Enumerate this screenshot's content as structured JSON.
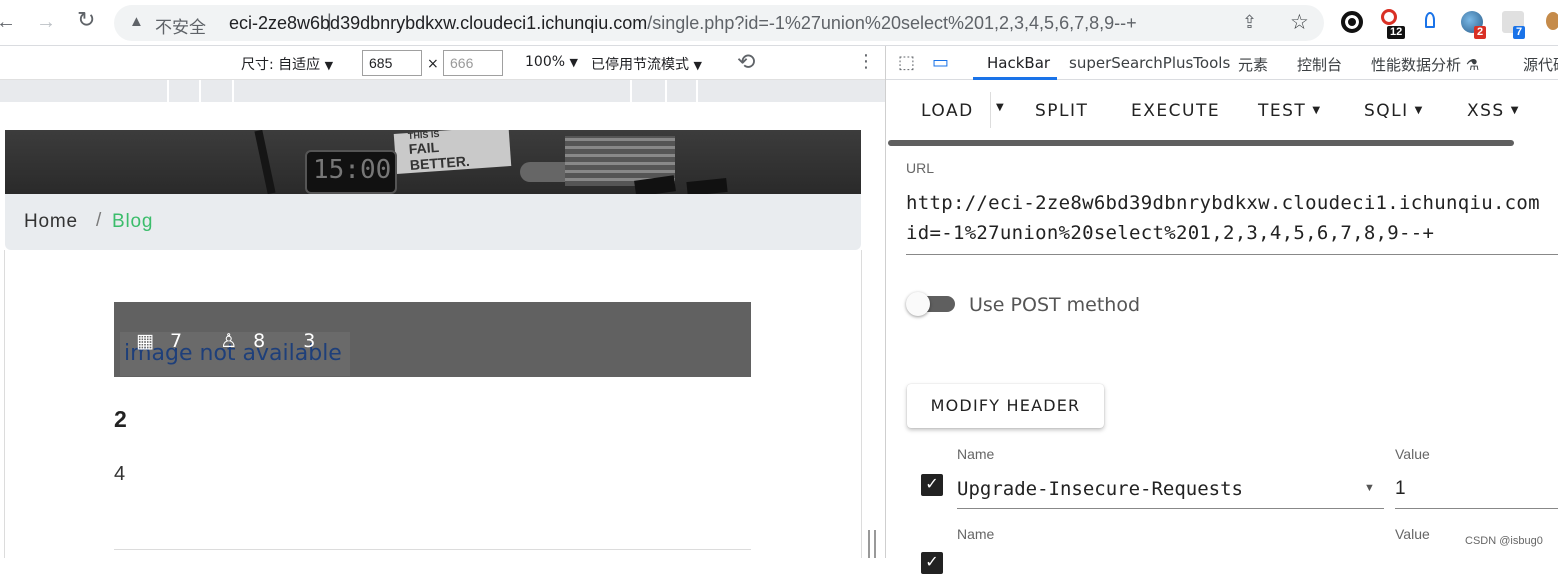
{
  "browser": {
    "security_warning": "不安全",
    "separator": "|",
    "url_host": "eci-2ze8w6bd39dbnrybdkxw.cloudeci1.ichunqiu.com",
    "url_path": "/single.php?id=-1%27union%20select%201,2,3,4,5,6,7,8,9--+",
    "ext_badges": [
      "12",
      "2",
      "7"
    ]
  },
  "device_toolbar": {
    "size_label": "尺寸: 自适应",
    "width": "685",
    "height_placeholder": "666",
    "times": "×",
    "zoom": "100%",
    "throttle": "已停用节流模式"
  },
  "page": {
    "hero_sign": "FAIL BETTER.",
    "hero_sign_top": "THIS IS",
    "hero_clock": "15:00",
    "breadcrumb": {
      "home": "Home",
      "slash": "/",
      "current": "Blog"
    },
    "broken_image_alt": "image not available",
    "meta_date": "7",
    "meta_author": "8",
    "meta_comments": "3",
    "post_title": "2",
    "post_body": "4"
  },
  "devtools": {
    "tabs": [
      "HackBar",
      "superSearchPlusTools",
      "元素",
      "控制台",
      "性能数据分析",
      "源代码"
    ],
    "hackbar": {
      "buttons": [
        "LOAD",
        "SPLIT",
        "EXECUTE",
        "TEST",
        "SQLI",
        "XSS"
      ],
      "url_label": "URL",
      "url_line1": "http://eci-2ze8w6bd39dbnrybdkxw.cloudeci1.ichunqiu.com",
      "url_line2": "id=-1%27union%20select%201,2,3,4,5,6,7,8,9--+",
      "post_toggle_label": "Use POST method",
      "post_enabled": false,
      "modify_header": "MODIFY HEADER",
      "headers": [
        {
          "name_label": "Name",
          "value_label": "Value",
          "name": "Upgrade-Insecure-Requests",
          "value": "1",
          "checked": true
        },
        {
          "name_label": "Name",
          "value_label": "Value",
          "name": "",
          "value": "",
          "checked": true
        }
      ]
    }
  },
  "watermark": "CSDN @isbug0",
  "colors": {
    "accent": "#1a73e8",
    "blog_green": "#3bbd6b",
    "breadcrumb_bg": "#e9ecef"
  }
}
